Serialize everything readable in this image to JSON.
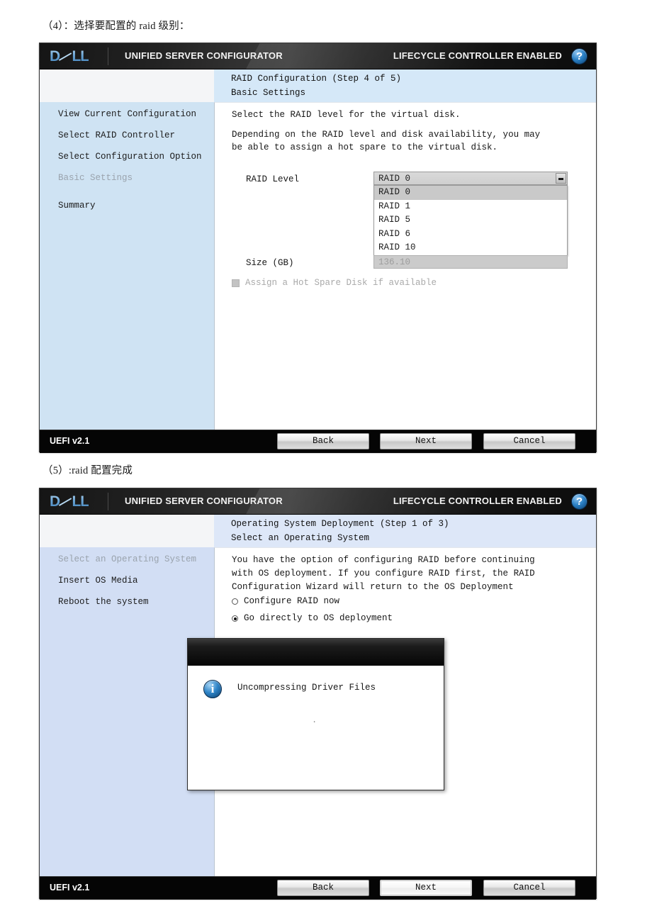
{
  "captions": {
    "first": "（4）：选择要配置的 raid 级别：",
    "second": "（5）:raid 配置完成"
  },
  "banner": {
    "logo_dell": "D",
    "logo_o": "&",
    "logo_ll": "LL",
    "logo_text": "DELL",
    "product": "UNIFIED SERVER CONFIGURATOR",
    "status": "LIFECYCLE CONTROLLER ENABLED",
    "help_glyph": "?",
    "help_name": "help-icon"
  },
  "footer": {
    "version": "UEFI v2.1",
    "back": "Back",
    "next": "Next",
    "cancel": "Cancel"
  },
  "window1": {
    "sidebar": [
      {
        "label": "View Current Configuration",
        "active": false
      },
      {
        "label": "Select RAID Controller",
        "active": false
      },
      {
        "label": "Select Configuration Option",
        "active": false
      },
      {
        "label": "Basic Settings",
        "active": true
      },
      {
        "label": "Summary",
        "active": false
      }
    ],
    "title_line1": "RAID Configuration (Step 4 of 5)",
    "title_line2": "Basic Settings",
    "intro": "Select the RAID level for the virtual disk.",
    "body_line1": "Depending on the RAID level and disk availability, you may",
    "body_line2": "be able to assign a hot spare to the virtual disk.",
    "raid_level_label": "RAID Level",
    "raid_level_value": "RAID 0",
    "raid_level_options": [
      "RAID 0",
      "RAID 1",
      "RAID 5",
      "RAID 6",
      "RAID 10"
    ],
    "raid_level_selected_index": 0,
    "size_label": "Size (GB)",
    "size_value": "136.10",
    "hotspare_label": "Assign a Hot Spare Disk if available",
    "hotspare_checked": false
  },
  "window2": {
    "sidebar": [
      {
        "label": "Select an Operating System",
        "active": true
      },
      {
        "label": "Insert OS Media",
        "active": false
      },
      {
        "label": "Reboot the system",
        "active": false
      }
    ],
    "title_line1": "Operating System Deployment (Step 1 of 3)",
    "title_line2": "Select an Operating System",
    "body_line1": "You have the option of configuring RAID before continuing",
    "body_line2": "with OS deployment.  If you configure RAID first, the RAID",
    "body_line3": "Configuration Wizard will return to the OS Deployment",
    "radio1": "Configure RAID now",
    "radio2": "Go directly to OS deployment",
    "radio_selected": 2,
    "modal": {
      "message": "Uncompressing Driver Files",
      "progress_dot": ".",
      "icon": "info-icon",
      "icon_glyph": "i"
    }
  },
  "colors": {
    "sidebar_blue_1": "#cfe3f3",
    "sidebar_blue_2": "#d2def4",
    "title_band_1": "#d5e8f8",
    "title_band_2": "#dde7f8",
    "dell_blue": "#7fb4e0",
    "banner_black": "#141414",
    "footer_black": "#050505"
  }
}
